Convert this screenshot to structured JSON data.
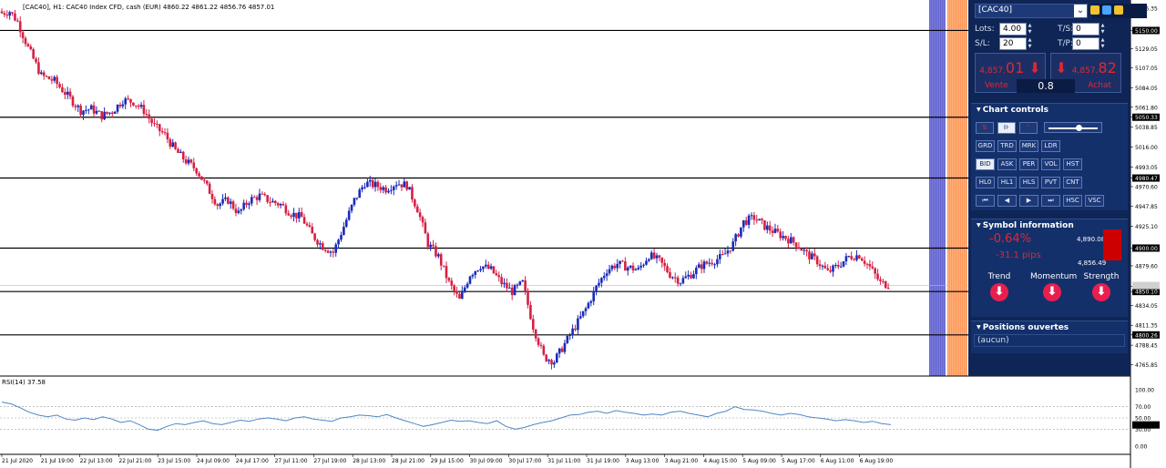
{
  "chart_header": "[CAC40], H1:  CAC40 Index CFD, cash (EUR)  4860.22 4861.22 4856.76 4857.01",
  "rsi_header": "RSI(14) 37.58",
  "chart_data": [
    {
      "type": "candlestick",
      "title": "[CAC40], H1: CAC40 Index CFD, cash (EUR)",
      "ohlc_last": {
        "open": 4860.22,
        "high": 4861.22,
        "low": 4856.76,
        "close": 4857.01
      },
      "ylim": [
        4753,
        5185
      ],
      "y_ticks": [
        "5175.35",
        "5150.00",
        "5129.05",
        "5107.05",
        "5084.05",
        "5061.80",
        "5050.33",
        "5038.85",
        "5016.00",
        "4993.05",
        "4980.47",
        "4970.60",
        "4947.85",
        "4925.10",
        "4900.00",
        "4879.60",
        "4856.10",
        "4850.10",
        "4834.05",
        "4811.35",
        "4800.26",
        "4788.45",
        "4765.85"
      ],
      "highlight_ticks": [
        "5150.00",
        "5050.33",
        "4980.47",
        "4900.00",
        "4850.10",
        "4800.26"
      ],
      "x_ticks": [
        "21 Jul 2020",
        "21 Jul 19:00",
        "22 Jul 13:00",
        "22 Jul 21:00",
        "23 Jul 15:00",
        "24 Jul 09:00",
        "24 Jul 17:00",
        "27 Jul 11:00",
        "27 Jul 19:00",
        "28 Jul 13:00",
        "28 Jul 21:00",
        "29 Jul 15:00",
        "30 Jul 09:00",
        "30 Jul 17:00",
        "31 Jul 11:00",
        "31 Jul 19:00",
        "3 Aug 13:00",
        "3 Aug 21:00",
        "4 Aug 15:00",
        "5 Aug 09:00",
        "5 Aug 17:00",
        "6 Aug 11:00",
        "6 Aug 19:00"
      ],
      "horizontal_levels": [
        5150.0,
        5050.33,
        4980.47,
        4900.0,
        4850.1,
        4800.26
      ],
      "current_price": 4857.01,
      "close_path": [
        [
          0,
          5170
        ],
        [
          3,
          5172
        ],
        [
          6,
          5160
        ],
        [
          10,
          5130
        ],
        [
          15,
          5098
        ],
        [
          20,
          5092
        ],
        [
          25,
          5075
        ],
        [
          30,
          5058
        ],
        [
          34,
          5060
        ],
        [
          38,
          5052
        ],
        [
          42,
          5057
        ],
        [
          46,
          5070
        ],
        [
          50,
          5068
        ],
        [
          54,
          5058
        ],
        [
          58,
          5040
        ],
        [
          62,
          5030
        ],
        [
          66,
          5012
        ],
        [
          70,
          5000
        ],
        [
          74,
          4990
        ],
        [
          78,
          4970
        ],
        [
          82,
          4950
        ],
        [
          86,
          4955
        ],
        [
          90,
          4940
        ],
        [
          94,
          4955
        ],
        [
          98,
          4960
        ],
        [
          102,
          4954
        ],
        [
          106,
          4950
        ],
        [
          110,
          4940
        ],
        [
          114,
          4935
        ],
        [
          118,
          4915
        ],
        [
          122,
          4902
        ],
        [
          126,
          4895
        ],
        [
          130,
          4925
        ],
        [
          134,
          4955
        ],
        [
          138,
          4975
        ],
        [
          142,
          4972
        ],
        [
          146,
          4968
        ],
        [
          150,
          4975
        ],
        [
          154,
          4972
        ],
        [
          158,
          4945
        ],
        [
          162,
          4905
        ],
        [
          166,
          4890
        ],
        [
          170,
          4860
        ],
        [
          174,
          4840
        ],
        [
          178,
          4870
        ],
        [
          182,
          4880
        ],
        [
          186,
          4875
        ],
        [
          190,
          4860
        ],
        [
          194,
          4850
        ],
        [
          198,
          4860
        ],
        [
          202,
          4810
        ],
        [
          206,
          4775
        ],
        [
          210,
          4770
        ],
        [
          214,
          4790
        ],
        [
          218,
          4810
        ],
        [
          222,
          4830
        ],
        [
          226,
          4855
        ],
        [
          230,
          4875
        ],
        [
          234,
          4882
        ],
        [
          238,
          4878
        ],
        [
          242,
          4875
        ],
        [
          246,
          4892
        ],
        [
          250,
          4885
        ],
        [
          254,
          4870
        ],
        [
          258,
          4862
        ],
        [
          262,
          4870
        ],
        [
          266,
          4880
        ],
        [
          270,
          4885
        ],
        [
          274,
          4890
        ],
        [
          278,
          4905
        ],
        [
          282,
          4930
        ],
        [
          286,
          4935
        ],
        [
          290,
          4925
        ],
        [
          294,
          4918
        ],
        [
          298,
          4912
        ],
        [
          302,
          4905
        ],
        [
          306,
          4893
        ],
        [
          310,
          4885
        ],
        [
          314,
          4872
        ],
        [
          318,
          4880
        ],
        [
          322,
          4890
        ],
        [
          326,
          4892
        ],
        [
          330,
          4878
        ],
        [
          334,
          4860
        ],
        [
          338,
          4857
        ]
      ]
    },
    {
      "type": "line",
      "title": "RSI(14) 37.58",
      "ylim": [
        0,
        100
      ],
      "y_ticks": [
        "100.00",
        "70.00",
        "50.00",
        "30.00",
        "0.00"
      ],
      "last_value": 37.58,
      "values": [
        78,
        75,
        68,
        60,
        55,
        52,
        55,
        48,
        46,
        50,
        47,
        52,
        48,
        42,
        45,
        38,
        30,
        28,
        35,
        40,
        38,
        42,
        45,
        40,
        38,
        42,
        46,
        44,
        48,
        50,
        48,
        45,
        50,
        52,
        48,
        46,
        44,
        50,
        52,
        55,
        54,
        52,
        56,
        50,
        45,
        40,
        35,
        38,
        42,
        46,
        44,
        45,
        42,
        40,
        45,
        35,
        30,
        33,
        38,
        42,
        45,
        50,
        55,
        56,
        60,
        62,
        58,
        63,
        60,
        58,
        55,
        57,
        55,
        60,
        62,
        58,
        55,
        52,
        58,
        62,
        70,
        65,
        64,
        62,
        58,
        55,
        58,
        56,
        52,
        50,
        48,
        45,
        47,
        45,
        42,
        44,
        40,
        38
      ]
    }
  ],
  "panel": {
    "symbol": "[CAC40]",
    "lots_label": "Lots:",
    "lots": "4.00",
    "sl_label": "S/L:",
    "sl": "20",
    "ts_label": "T/S:",
    "ts": "0",
    "tp_label": "T/P:",
    "tp": "0",
    "sell_big": "4,857.",
    "sell_small": "01",
    "sell_label": "Vente",
    "buy_big": "4,857.",
    "buy_small": "82",
    "buy_label": "Achat",
    "spread": "0.8",
    "chart_controls_title": "Chart controls",
    "row2": [
      "GRD",
      "TRD",
      "MRK",
      "LDR"
    ],
    "row3": [
      "BID",
      "ASK",
      "PER",
      "VOL",
      "HST"
    ],
    "row4": [
      "HL0",
      "HL1",
      "HLS",
      "PVT",
      "CNT"
    ],
    "row5": [
      "HSC",
      "VSC"
    ],
    "symbol_info_title": "Symbol information",
    "change_pct": "-0.64%",
    "change_pips": "-31.1 pips",
    "high": "4,890.08",
    "low": "4,856.49",
    "trend": "Trend",
    "momentum": "Momentum",
    "strength": "Strength",
    "positions_title": "Positions ouvertes",
    "positions_empty": "(aucun)"
  },
  "colors": {
    "bull": "#1a2bb8",
    "bear": "#d61f45",
    "panel_bg": "#0f2556",
    "rsi": "#4f86c4"
  }
}
